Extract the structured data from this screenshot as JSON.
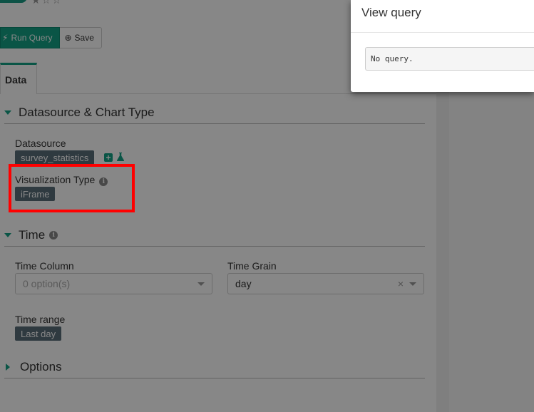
{
  "toolbar": {
    "run_query_label": "Run Query",
    "save_label": "Save"
  },
  "tabs": [
    {
      "label": "Data",
      "active": true
    }
  ],
  "sections": {
    "datasource_chart": {
      "title": "Datasource & Chart Type",
      "expanded": true,
      "datasource_label": "Datasource",
      "datasource_value": "survey_statistics",
      "viz_type_label": "Visualization Type",
      "viz_type_value": "iFrame"
    },
    "time": {
      "title": "Time",
      "expanded": true,
      "time_column_label": "Time Column",
      "time_column_placeholder": "0 option(s)",
      "time_grain_label": "Time Grain",
      "time_grain_value": "day",
      "time_range_label": "Time range",
      "time_range_value": "Last day"
    },
    "options": {
      "title": "Options",
      "expanded": false
    }
  },
  "modal": {
    "title": "View query",
    "query_text": "No query."
  },
  "colors": {
    "accent": "#14a085",
    "tag_bg": "#5a6e7a",
    "highlight": "#ff0000"
  }
}
